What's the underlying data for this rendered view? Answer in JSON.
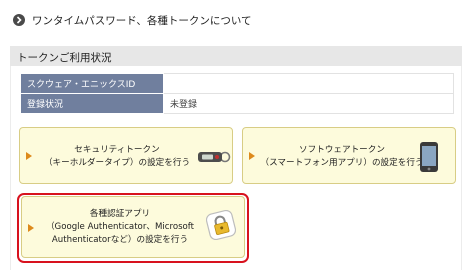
{
  "breadcrumb": {
    "text": "ワンタイムパスワード、各種トークンについて"
  },
  "section": {
    "title": "トークンご利用状況"
  },
  "status_table": {
    "rows": [
      {
        "label": "スクウェア・エニックスID",
        "value": ""
      },
      {
        "label": "登録状況",
        "value": "未登録"
      }
    ]
  },
  "cards": {
    "security_token": {
      "line1": "セキュリティトークン",
      "line2": "（キーホルダータイプ）の設定を行う",
      "icon": "keychain-token-icon"
    },
    "software_token": {
      "line1": "ソフトウェアトークン",
      "line2": "（スマートフォン用アプリ）の設定を行う",
      "icon": "smartphone-icon"
    },
    "authenticator_app": {
      "line1": "各種認証アプリ",
      "line2": "（Google Authenticator、Microsoft",
      "line3": "Authenticatorなど）の設定を行う",
      "icon": "padlock-icon"
    }
  },
  "colors": {
    "card_background": "#fdfbdc",
    "card_border": "#d8cd85",
    "arrow": "#dd8a1c",
    "table_header": "#707f9e",
    "highlight_border": "#d8121e"
  }
}
